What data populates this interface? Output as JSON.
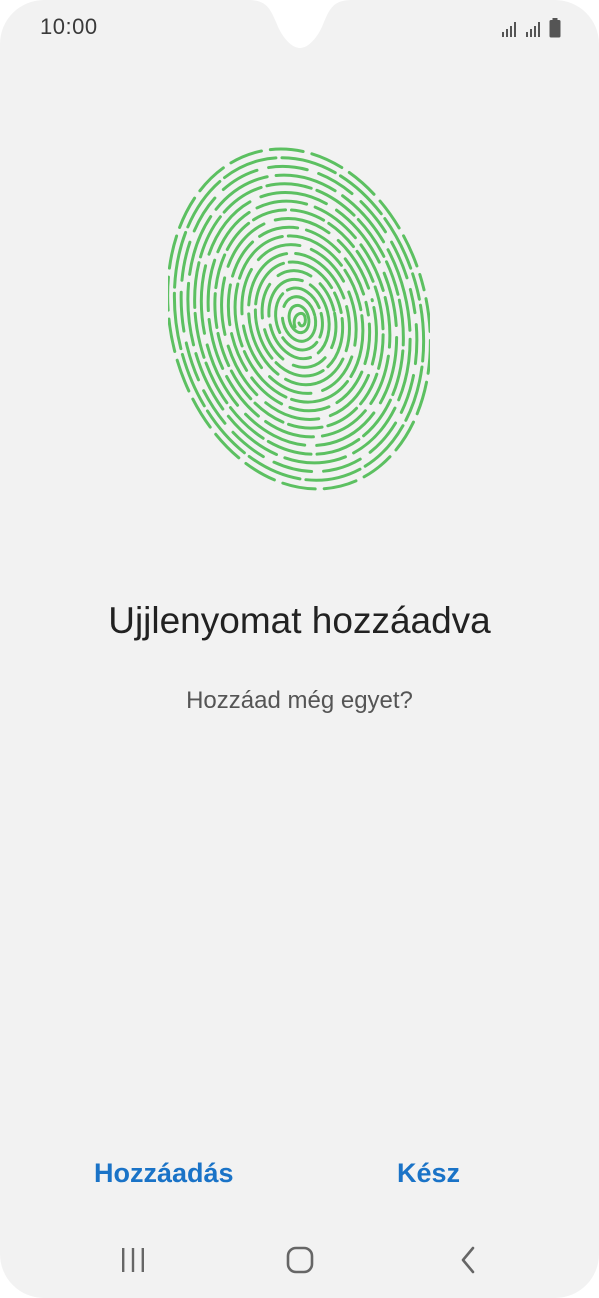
{
  "status_bar": {
    "time": "10:00",
    "icons": [
      "signal-icon",
      "signal-icon",
      "battery-icon"
    ]
  },
  "main": {
    "illustration": "fingerprint-icon",
    "accent_color": "#5cc061",
    "title": "Ujjlenyomat hozzáadva",
    "subtitle": "Hozzáad még egyet?"
  },
  "actions": {
    "add_label": "Hozzáadás",
    "done_label": "Kész",
    "color": "#1a73c7"
  },
  "navigation_bar": {
    "buttons": [
      "recent-apps-icon",
      "home-icon",
      "back-icon"
    ]
  }
}
